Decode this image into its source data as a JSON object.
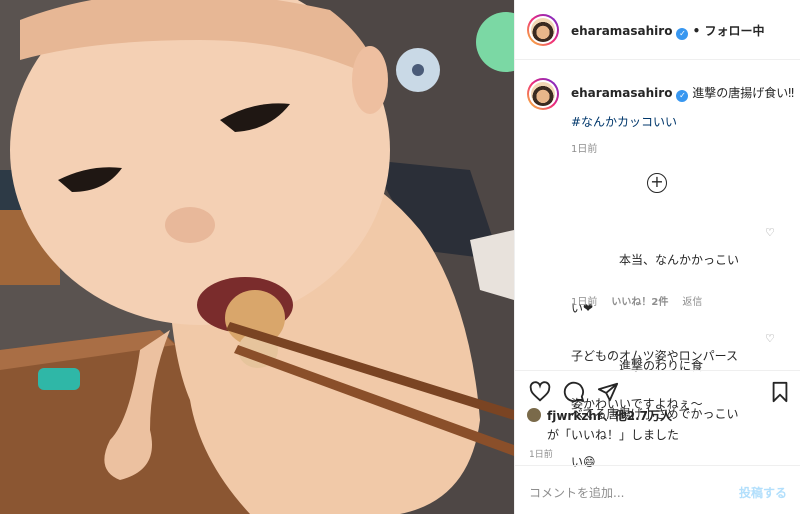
{
  "post_author": {
    "username": "eharamasahiro",
    "separator": "•",
    "follow_state": "フォロー中"
  },
  "caption": {
    "username": "eharamasahiro",
    "text": "進撃の唐揚げ食い‼",
    "hashtag": "#なんかカッコいい",
    "timestamp": "1日前"
  },
  "load_more_icon": "plus-circle-icon",
  "comments": [
    {
      "lines": [
        "　　　　本当、なんかかっこい",
        "い❤",
        "子どものオムツ姿やロンパース",
        "姿かわいいですよねぇ～"
      ],
      "timestamp": "1日前",
      "likes": "いいね！2件",
      "reply": "返信"
    },
    {
      "lines": [
        "　　　　進撃のわりに食",
        "べてる唐揚げ小さめでかっこい",
        "い😄"
      ],
      "timestamp": "",
      "likes": "",
      "reply": ""
    }
  ],
  "actions": {
    "like_icon": "heart-icon",
    "comment_icon": "comment-icon",
    "share_icon": "send-icon",
    "save_icon": "bookmark-icon"
  },
  "likes": {
    "liker": "fjwrkzhr、",
    "others": "他2.7万人",
    "suffix": "が「いいね！」しました",
    "timestamp": "1日前"
  },
  "comment_box": {
    "placeholder": "コメントを追加...",
    "post_label": "投稿する"
  },
  "colors": {
    "link": "#00376b",
    "verified": "#3897f0",
    "post_disabled": "#b2dffc",
    "muted": "#8e8e8e"
  }
}
